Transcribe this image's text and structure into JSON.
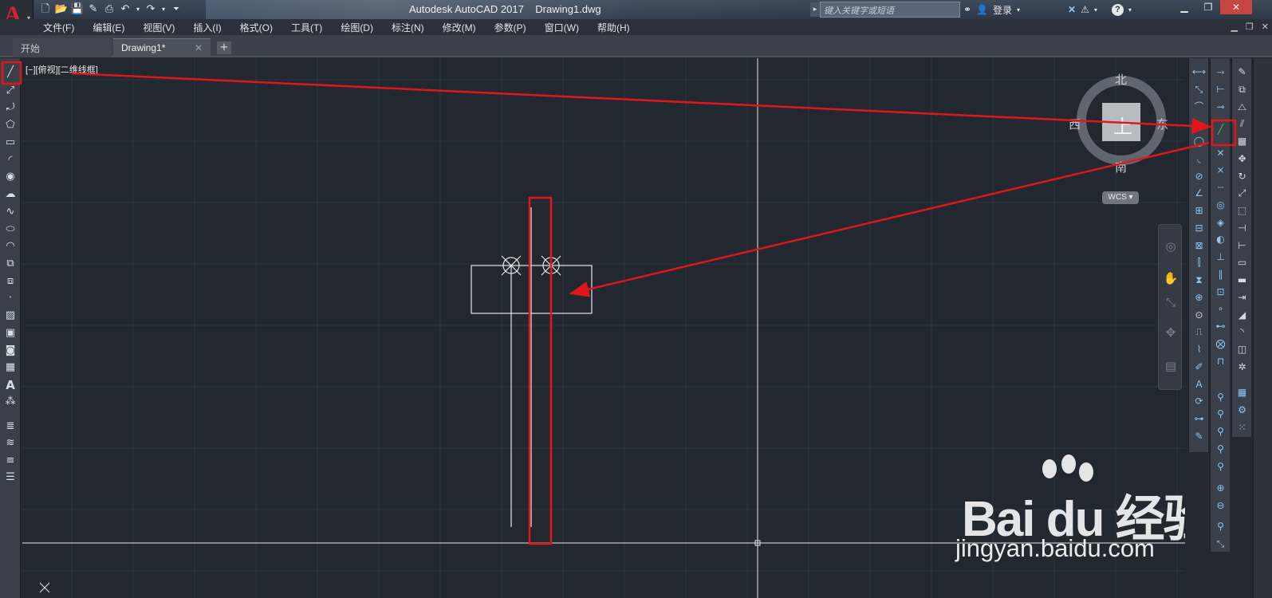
{
  "app": {
    "name": "Autodesk AutoCAD 2017",
    "file": "Drawing1.dwg",
    "logo_letter": "A"
  },
  "search": {
    "placeholder": "键入关键字或短语"
  },
  "title_tools": {
    "login": "登录",
    "help": "?"
  },
  "menus": [
    "文件(F)",
    "编辑(E)",
    "视图(V)",
    "插入(I)",
    "格式(O)",
    "工具(T)",
    "绘图(D)",
    "标注(N)",
    "修改(M)",
    "参数(P)",
    "窗口(W)",
    "帮助(H)"
  ],
  "tabs": {
    "start": "开始",
    "drawing": "Drawing1*",
    "add": "+"
  },
  "viewport": {
    "label": "[−][俯视][二维线框]"
  },
  "viewcube": {
    "north": "北",
    "south": "南",
    "east": "东",
    "west": "西",
    "top": "上",
    "wcs": "WCS"
  },
  "watermark": {
    "brand": "Bai du 经验",
    "url": "jingyan.baidu.com"
  },
  "colors": {
    "viewport_bg": "#212830",
    "annotation_red": "#e0161b",
    "accent": "#d1232a"
  }
}
